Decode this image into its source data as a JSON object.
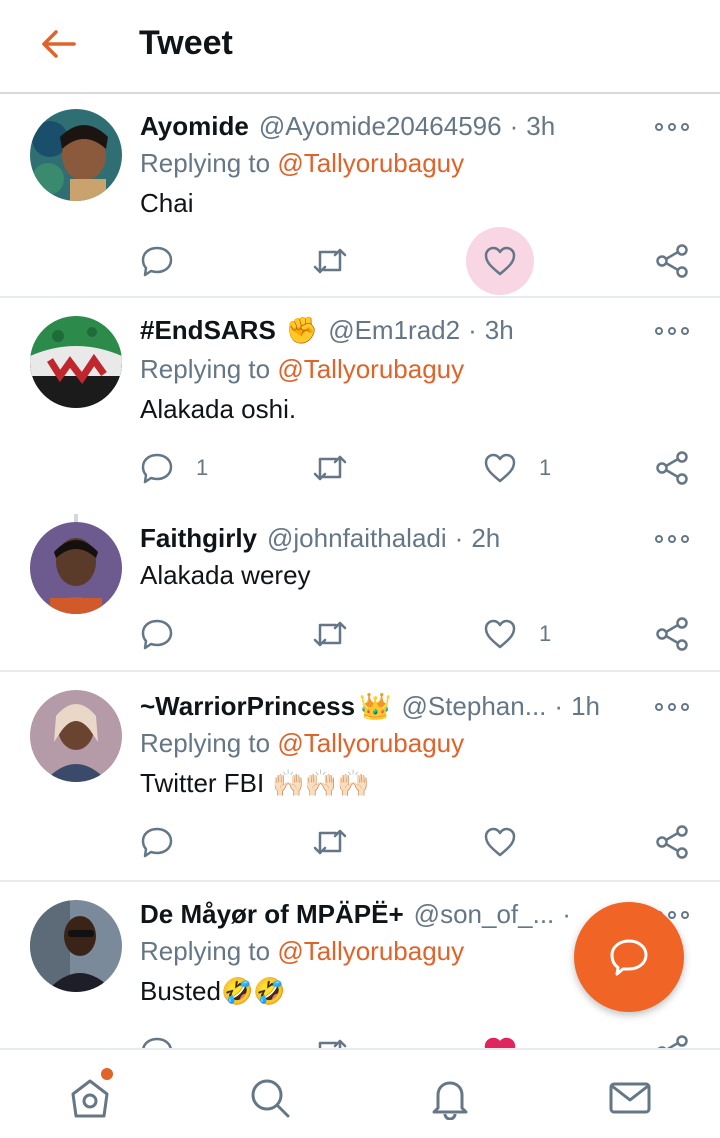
{
  "header": {
    "title": "Tweet",
    "back_icon": "back-arrow-icon"
  },
  "colors": {
    "accent": "#e0632a",
    "fab": "#f06426",
    "secondary_text": "#657786",
    "like_highlight": "#f9d6e3"
  },
  "tweets": [
    {
      "name": "Ayomide",
      "handle": "@Ayomide20464596",
      "sep": "·",
      "time": "3h",
      "replying_label": "Replying to",
      "replying_to": "@Tallyorubaguy",
      "text": "Chai",
      "reply_count": "",
      "retweet_count": "",
      "like_count": ""
    },
    {
      "name": "#EndSARS",
      "name_emoji": "✊",
      "handle": "@Em1rad2",
      "sep": "·",
      "time": "3h",
      "replying_label": "Replying to",
      "replying_to": "@Tallyorubaguy",
      "text": "Alakada oshi.",
      "reply_count": "1",
      "retweet_count": "",
      "like_count": "1"
    },
    {
      "name": "Faithgirly",
      "handle": "@johnfaithaladi",
      "sep": "·",
      "time": "2h",
      "text": "Alakada werey",
      "reply_count": "",
      "retweet_count": "",
      "like_count": "1"
    },
    {
      "name": "~WarriorPrincess",
      "name_emoji": "👑",
      "handle": "@Stephan...",
      "sep": "·",
      "time": "1h",
      "replying_label": "Replying to",
      "replying_to": "@Tallyorubaguy",
      "text": "Twitter FBI",
      "text_emoji": "🙌🏻🙌🏻🙌🏻",
      "reply_count": "",
      "retweet_count": "",
      "like_count": ""
    },
    {
      "name": "De Måyør of MPÄPË+",
      "handle": "@son_of_...",
      "sep": "·",
      "time": "",
      "replying_label": "Replying to",
      "replying_to": "@Tallyorubaguy",
      "text": "Busted",
      "text_emoji": "🤣🤣",
      "reply_count": "",
      "retweet_count": "",
      "like_count": ""
    }
  ],
  "fab": {
    "icon": "compose-reply-icon"
  },
  "bottom_nav": [
    {
      "name": "home",
      "icon": "home-icon",
      "active": true,
      "has_notification": true
    },
    {
      "name": "search",
      "icon": "search-icon"
    },
    {
      "name": "notifications",
      "icon": "bell-icon"
    },
    {
      "name": "messages",
      "icon": "mail-icon"
    }
  ]
}
